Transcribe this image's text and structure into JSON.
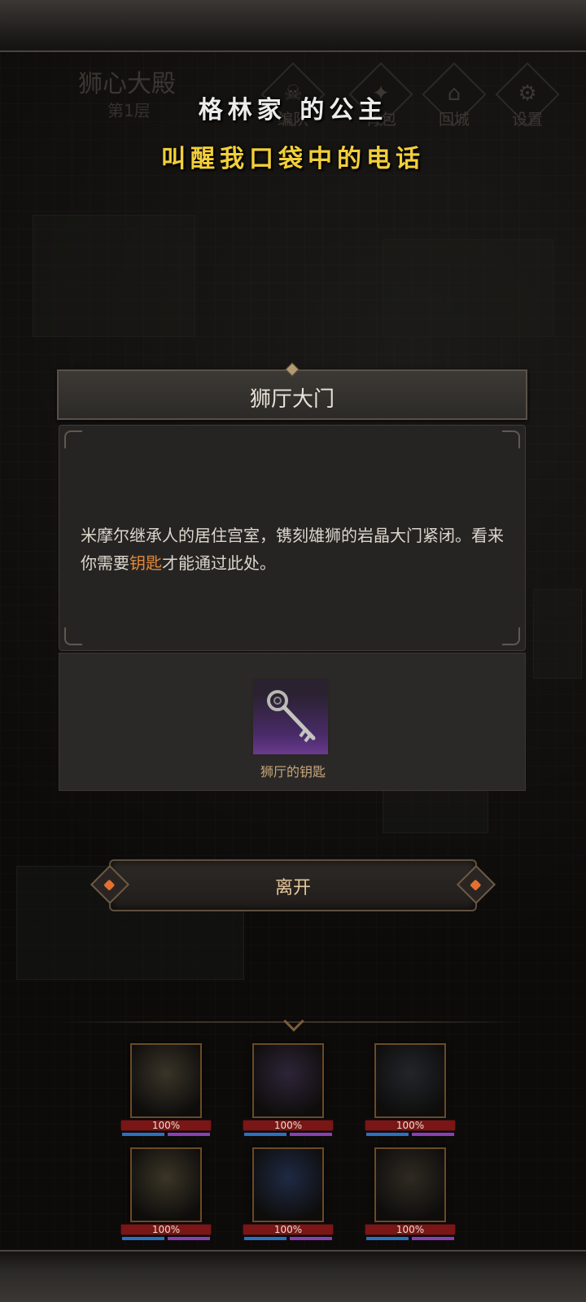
{
  "map": {
    "location_title": "狮心大殿",
    "floor": "第1层"
  },
  "top_menu": [
    {
      "glyph": "☠",
      "label": "编队"
    },
    {
      "glyph": "✦",
      "label": "背包"
    },
    {
      "glyph": "⌂",
      "label": "回城"
    },
    {
      "glyph": "⚙",
      "label": "设置"
    }
  ],
  "lyrics": {
    "line1": "格林家 的公主",
    "line2": "叫醒我口袋中的电话"
  },
  "dialog": {
    "title": "狮厅大门",
    "description_before": "米摩尔继承人的居住宫室，镌刻雄狮的岩晶大门紧闭。看来你需要",
    "description_highlight": "钥匙",
    "description_after": "才能通过此处。",
    "item_name": "狮厅的钥匙",
    "leave_label": "离开"
  },
  "party": [
    {
      "hp": "100%",
      "tint": "#3a3428"
    },
    {
      "hp": "100%",
      "tint": "#2e2438"
    },
    {
      "hp": "100%",
      "tint": "#22252a"
    },
    {
      "hp": "100%",
      "tint": "#3b3526"
    },
    {
      "hp": "100%",
      "tint": "#1e2a44"
    },
    {
      "hp": "100%",
      "tint": "#2f2a22"
    }
  ],
  "colors": {
    "highlight": "#e2883a",
    "lyric_primary": "#ececec",
    "lyric_secondary": "#f2cf3a",
    "hp_bar": "#7a1616"
  }
}
